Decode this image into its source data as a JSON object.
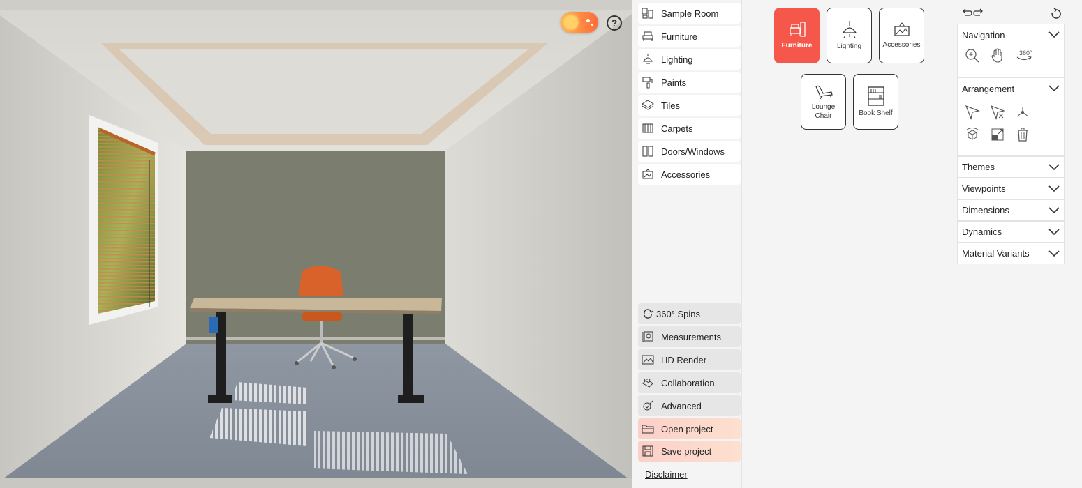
{
  "viewport": {
    "help_label": "?"
  },
  "menu": {
    "items": [
      {
        "label": "Sample Room",
        "icon": "sample-room-icon"
      },
      {
        "label": "Furniture",
        "icon": "furniture-icon"
      },
      {
        "label": "Lighting",
        "icon": "lighting-icon"
      },
      {
        "label": "Paints",
        "icon": "paints-icon"
      },
      {
        "label": "Tiles",
        "icon": "tiles-icon"
      },
      {
        "label": "Carpets",
        "icon": "carpets-icon"
      },
      {
        "label": "Doors/Windows",
        "icon": "doors-windows-icon"
      },
      {
        "label": "Accessories",
        "icon": "accessories-icon"
      }
    ],
    "tools": [
      {
        "label": "360° Spins",
        "icon": "spin-icon"
      },
      {
        "label": "Measurements",
        "icon": "measurements-icon"
      },
      {
        "label": "HD Render",
        "icon": "hd-render-icon"
      },
      {
        "label": "Collaboration",
        "icon": "collaboration-icon"
      },
      {
        "label": "Advanced",
        "icon": "advanced-icon"
      },
      {
        "label": "Open project",
        "icon": "folder-icon"
      },
      {
        "label": "Save project",
        "icon": "save-icon"
      }
    ],
    "disclaimer": "Disclaimer"
  },
  "catalog": {
    "cards": [
      {
        "label": "Furniture",
        "active": true
      },
      {
        "label": "Lighting",
        "active": false
      },
      {
        "label": "Accessories",
        "active": false
      },
      {
        "label": "Lounge Chair",
        "active": false
      },
      {
        "label": "Book Shelf",
        "active": false
      }
    ]
  },
  "controls": {
    "navigation": "Navigation",
    "arrangement": "Arrangement",
    "sections": [
      "Themes",
      "Viewpoints",
      "Dimensions",
      "Dynamics",
      "Material Variants"
    ],
    "rotate_label": "360°"
  },
  "colors": {
    "accent": "#f5574b",
    "wall_back": "#7b7e6e",
    "floor": "#8a929e"
  }
}
